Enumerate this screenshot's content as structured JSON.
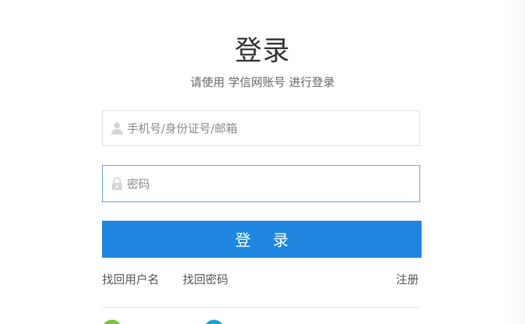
{
  "login": {
    "title": "登录",
    "subtitle": "请使用 学信网账号 进行登录",
    "username": {
      "placeholder": "手机号/身份证号/邮箱",
      "icon": "user-icon"
    },
    "password": {
      "placeholder": "密码",
      "icon": "lock-icon"
    },
    "submit_label": "登 录",
    "links": {
      "forgot_username": "找回用户名",
      "forgot_password": "找回密码",
      "register": "注册"
    }
  },
  "colors": {
    "primary": "#1f87e0",
    "focus_border": "#5b9bd5",
    "border": "#dcdcdc",
    "social_green": "#7cc23a",
    "social_blue": "#1aa0d8"
  }
}
